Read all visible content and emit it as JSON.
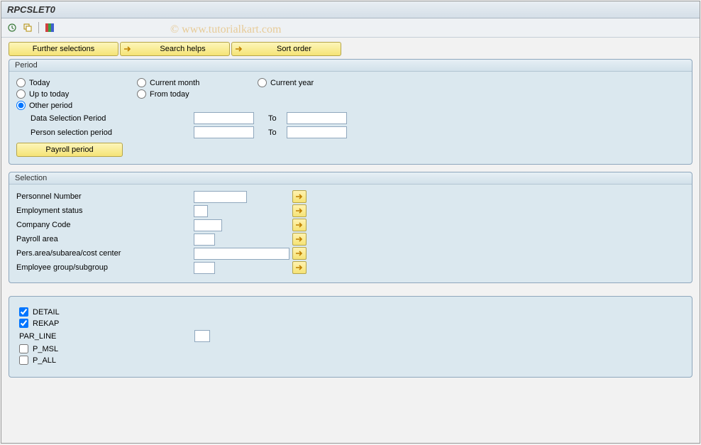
{
  "title": "RPCSLET0",
  "watermark": "© www.tutorialkart.com",
  "toolbar": {
    "further_selections": "Further selections",
    "search_helps": "Search helps",
    "sort_order": "Sort order"
  },
  "period": {
    "title": "Period",
    "today": "Today",
    "current_month": "Current month",
    "current_year": "Current year",
    "up_to_today": "Up to today",
    "from_today": "From today",
    "other_period": "Other period",
    "data_selection_period": "Data Selection Period",
    "person_selection_period": "Person selection period",
    "to": "To",
    "payroll_period": "Payroll period"
  },
  "selection": {
    "title": "Selection",
    "personnel_number": "Personnel Number",
    "employment_status": "Employment status",
    "company_code": "Company Code",
    "payroll_area": "Payroll area",
    "pers_area": "Pers.area/subarea/cost center",
    "employee_group": "Employee group/subgroup"
  },
  "options": {
    "detail": "DETAIL",
    "rekap": "REKAP",
    "par_line": "PAR_LINE",
    "p_msl": "P_MSL",
    "p_all": "P_ALL"
  }
}
